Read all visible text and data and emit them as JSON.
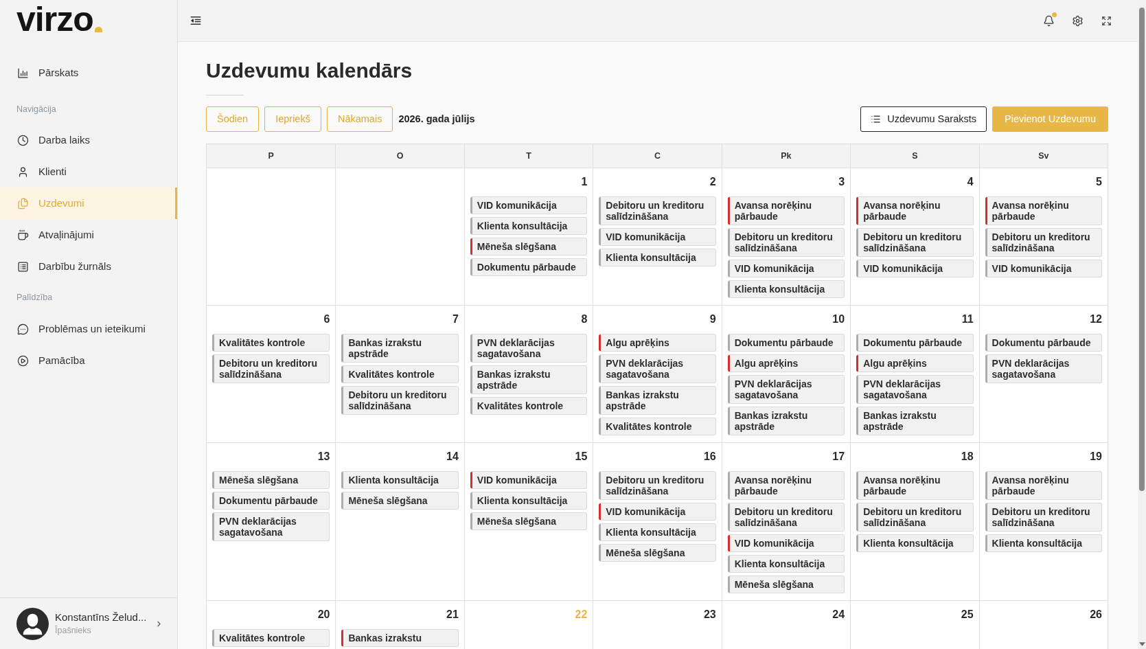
{
  "sidebar": {
    "logo": "virzo",
    "sections": [
      {
        "items": [
          {
            "label": "Pārskats",
            "selected": false
          }
        ]
      },
      {
        "heading": "Navigācija",
        "items": [
          {
            "label": "Darba laiks",
            "selected": false
          },
          {
            "label": "Klienti",
            "selected": false
          },
          {
            "label": "Uzdevumi",
            "selected": true
          },
          {
            "label": "Atvaļinājumi",
            "selected": false
          },
          {
            "label": "Darbību žurnāls",
            "selected": false
          }
        ]
      },
      {
        "heading": "Palīdzība",
        "items": [
          {
            "label": "Problēmas un ieteikumi",
            "selected": false
          },
          {
            "label": "Pamācība",
            "selected": false
          }
        ]
      }
    ],
    "user": {
      "name": "Konstantīns Želud...",
      "role": "Īpašnieks"
    }
  },
  "top_bar": {
    "has_unread_notifications": true
  },
  "page": {
    "title": "Uzdevumu kalendārs",
    "nav_buttons": [
      "Šodien",
      "Iepriekš",
      "Nākamais"
    ],
    "period": "2026. gada jūlijs",
    "actions": [
      {
        "kind": "outline",
        "label": "Uzdevumu Saraksts"
      },
      {
        "kind": "primary",
        "label": "Pievienot Uzdevumu"
      }
    ]
  },
  "calendar": {
    "weekdays": [
      "P",
      "O",
      "T",
      "C",
      "Pk",
      "S",
      "Sv"
    ],
    "weeks": [
      {
        "days": [
          {
            "kind": "blank"
          },
          {
            "kind": "blank"
          },
          {
            "kind": "day",
            "date": "1",
            "today": false,
            "events": [
              {
                "title": "VID komunikācija",
                "color": "#acacac"
              },
              {
                "title": "Klienta konsultācija",
                "color": "#acacac"
              },
              {
                "title": "Mēneša slēgšana",
                "color": "#d32f2f"
              },
              {
                "title": "Dokumentu pārbaude",
                "color": "#acacac"
              }
            ]
          },
          {
            "kind": "day",
            "date": "2",
            "today": false,
            "events": [
              {
                "title": "Debitoru un kreditoru salīdzināšana",
                "color": "#acacac"
              },
              {
                "title": "VID komunikācija",
                "color": "#acacac"
              },
              {
                "title": "Klienta konsultācija",
                "color": "#acacac"
              }
            ]
          },
          {
            "kind": "day",
            "date": "3",
            "today": false,
            "events": [
              {
                "title": "Avansa norēķinu pārbaude",
                "color": "#d32f2f"
              },
              {
                "title": "Debitoru un kreditoru salīdzināšana",
                "color": "#acacac"
              },
              {
                "title": "VID komunikācija",
                "color": "#acacac"
              },
              {
                "title": "Klienta konsultācija",
                "color": "#acacac"
              }
            ]
          },
          {
            "kind": "day",
            "date": "4",
            "today": false,
            "events": [
              {
                "title": "Avansa norēķinu pārbaude",
                "color": "#d32f2f"
              },
              {
                "title": "Debitoru un kreditoru salīdzināšana",
                "color": "#acacac"
              },
              {
                "title": "VID komunikācija",
                "color": "#acacac"
              }
            ]
          },
          {
            "kind": "day",
            "date": "5",
            "today": false,
            "events": [
              {
                "title": "Avansa norēķinu pārbaude",
                "color": "#d32f2f"
              },
              {
                "title": "Debitoru un kreditoru salīdzināšana",
                "color": "#acacac"
              },
              {
                "title": "VID komunikācija",
                "color": "#acacac"
              }
            ]
          }
        ]
      },
      {
        "days": [
          {
            "kind": "day",
            "date": "6",
            "today": false,
            "events": [
              {
                "title": "Kvalitātes kontrole",
                "color": "#acacac"
              },
              {
                "title": "Debitoru un kreditoru salīdzināšana",
                "color": "#acacac"
              }
            ]
          },
          {
            "kind": "day",
            "date": "7",
            "today": false,
            "events": [
              {
                "title": "Bankas izrakstu apstrāde",
                "color": "#acacac"
              },
              {
                "title": "Kvalitātes kontrole",
                "color": "#acacac"
              },
              {
                "title": "Debitoru un kreditoru salīdzināšana",
                "color": "#acacac"
              }
            ]
          },
          {
            "kind": "day",
            "date": "8",
            "today": false,
            "events": [
              {
                "title": "PVN deklarācijas sagatavošana",
                "color": "#acacac"
              },
              {
                "title": "Bankas izrakstu apstrāde",
                "color": "#acacac"
              },
              {
                "title": "Kvalitātes kontrole",
                "color": "#acacac"
              }
            ]
          },
          {
            "kind": "day",
            "date": "9",
            "today": false,
            "events": [
              {
                "title": "Algu aprēķins",
                "color": "#d32f2f"
              },
              {
                "title": "PVN deklarācijas sagatavošana",
                "color": "#acacac"
              },
              {
                "title": "Bankas izrakstu apstrāde",
                "color": "#acacac"
              },
              {
                "title": "Kvalitātes kontrole",
                "color": "#acacac"
              }
            ]
          },
          {
            "kind": "day",
            "date": "10",
            "today": false,
            "events": [
              {
                "title": "Dokumentu pārbaude",
                "color": "#acacac"
              },
              {
                "title": "Algu aprēķins",
                "color": "#d32f2f"
              },
              {
                "title": "PVN deklarācijas sagatavošana",
                "color": "#acacac"
              },
              {
                "title": "Bankas izrakstu apstrāde",
                "color": "#acacac"
              }
            ]
          },
          {
            "kind": "day",
            "date": "11",
            "today": false,
            "events": [
              {
                "title": "Dokumentu pārbaude",
                "color": "#acacac"
              },
              {
                "title": "Algu aprēķins",
                "color": "#d32f2f"
              },
              {
                "title": "PVN deklarācijas sagatavošana",
                "color": "#acacac"
              },
              {
                "title": "Bankas izrakstu apstrāde",
                "color": "#acacac"
              }
            ]
          },
          {
            "kind": "day",
            "date": "12",
            "today": false,
            "events": [
              {
                "title": "Dokumentu pārbaude",
                "color": "#acacac"
              },
              {
                "title": "PVN deklarācijas sagatavošana",
                "color": "#acacac"
              }
            ]
          }
        ]
      },
      {
        "days": [
          {
            "kind": "day",
            "date": "13",
            "today": false,
            "events": [
              {
                "title": "Mēneša slēgšana",
                "color": "#acacac"
              },
              {
                "title": "Dokumentu pārbaude",
                "color": "#acacac"
              },
              {
                "title": "PVN deklarācijas sagatavošana",
                "color": "#acacac"
              }
            ]
          },
          {
            "kind": "day",
            "date": "14",
            "today": false,
            "events": [
              {
                "title": "Klienta konsultācija",
                "color": "#acacac"
              },
              {
                "title": "Mēneša slēgšana",
                "color": "#acacac"
              }
            ]
          },
          {
            "kind": "day",
            "date": "15",
            "today": false,
            "events": [
              {
                "title": "VID komunikācija",
                "color": "#d32f2f"
              },
              {
                "title": "Klienta konsultācija",
                "color": "#acacac"
              },
              {
                "title": "Mēneša slēgšana",
                "color": "#acacac"
              }
            ]
          },
          {
            "kind": "day",
            "date": "16",
            "today": false,
            "events": [
              {
                "title": "Debitoru un kreditoru salīdzināšana",
                "color": "#acacac"
              },
              {
                "title": "VID komunikācija",
                "color": "#d32f2f"
              },
              {
                "title": "Klienta konsultācija",
                "color": "#acacac"
              },
              {
                "title": "Mēneša slēgšana",
                "color": "#acacac"
              }
            ]
          },
          {
            "kind": "day",
            "date": "17",
            "today": false,
            "events": [
              {
                "title": "Avansa norēķinu pārbaude",
                "color": "#acacac"
              },
              {
                "title": "Debitoru un kreditoru salīdzināšana",
                "color": "#acacac"
              },
              {
                "title": "VID komunikācija",
                "color": "#d32f2f"
              },
              {
                "title": "Klienta konsultācija",
                "color": "#acacac"
              },
              {
                "title": "Mēneša slēgšana",
                "color": "#acacac"
              }
            ]
          },
          {
            "kind": "day",
            "date": "18",
            "today": false,
            "events": [
              {
                "title": "Avansa norēķinu pārbaude",
                "color": "#acacac"
              },
              {
                "title": "Debitoru un kreditoru salīdzināšana",
                "color": "#acacac"
              },
              {
                "title": "Klienta konsultācija",
                "color": "#acacac"
              }
            ]
          },
          {
            "kind": "day",
            "date": "19",
            "today": false,
            "events": [
              {
                "title": "Avansa norēķinu pārbaude",
                "color": "#acacac"
              },
              {
                "title": "Debitoru un kreditoru salīdzināšana",
                "color": "#acacac"
              },
              {
                "title": "Klienta konsultācija",
                "color": "#acacac"
              }
            ]
          }
        ]
      },
      {
        "days": [
          {
            "kind": "day",
            "date": "20",
            "today": false,
            "events": [
              {
                "title": "Kvalitātes kontrole",
                "color": "#acacac"
              }
            ]
          },
          {
            "kind": "day",
            "date": "21",
            "today": false,
            "events": [
              {
                "title": "Bankas izrakstu",
                "color": "#d32f2f"
              }
            ]
          },
          {
            "kind": "day",
            "date": "22",
            "today": true
          },
          {
            "kind": "day",
            "date": "23",
            "today": false
          },
          {
            "kind": "day",
            "date": "24",
            "today": false
          },
          {
            "kind": "day",
            "date": "25",
            "today": false
          },
          {
            "kind": "day",
            "date": "26",
            "today": false
          }
        ]
      }
    ]
  }
}
